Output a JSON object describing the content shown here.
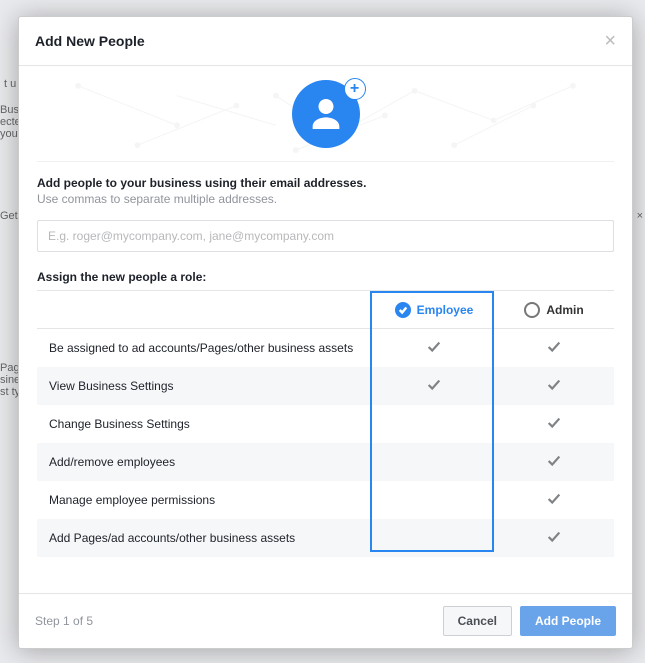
{
  "modal": {
    "title": "Add New People",
    "hero_plus": "+",
    "instruction_bold": "Add people to your business using their email addresses.",
    "instruction_sub": "Use commas to separate multiple addresses.",
    "email_placeholder": "E.g. roger@mycompany.com, jane@mycompany.com",
    "assign_label": "Assign the new people a role:",
    "roles": {
      "employee": "Employee",
      "admin": "Admin",
      "selected": "employee"
    },
    "permissions": [
      {
        "label": "Be assigned to ad accounts/Pages/other business assets",
        "employee": true,
        "admin": true
      },
      {
        "label": "View Business Settings",
        "employee": true,
        "admin": true
      },
      {
        "label": "Change Business Settings",
        "employee": false,
        "admin": true
      },
      {
        "label": "Add/remove employees",
        "employee": false,
        "admin": true
      },
      {
        "label": "Manage employee permissions",
        "employee": false,
        "admin": true
      },
      {
        "label": "Add Pages/ad accounts/other business assets",
        "employee": false,
        "admin": true
      }
    ],
    "step": "Step 1 of 5",
    "buttons": {
      "cancel": "Cancel",
      "add": "Add People"
    }
  },
  "colors": {
    "accent": "#2985f0"
  }
}
